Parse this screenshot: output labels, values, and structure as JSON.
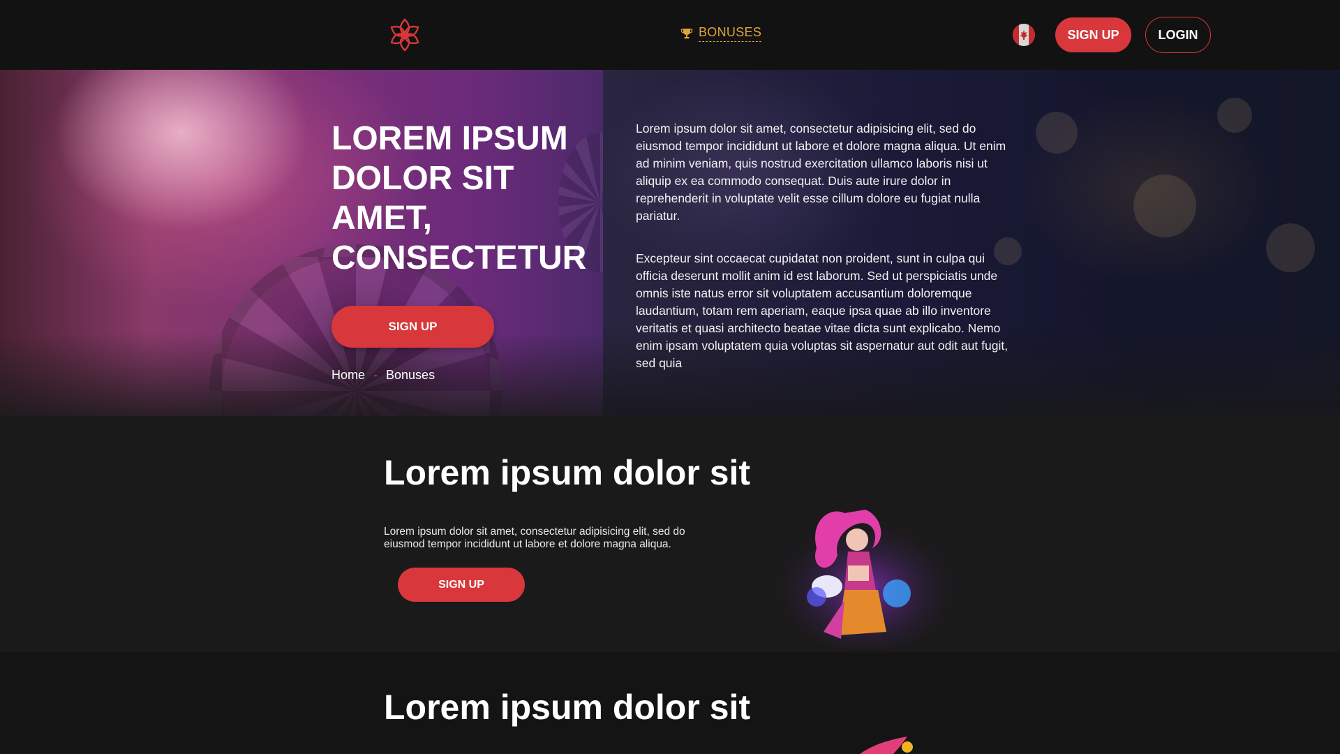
{
  "header": {
    "nav_bonuses": "BONUSES",
    "signup": "SIGN UP",
    "login": "LOGIN"
  },
  "hero": {
    "title": "LOREM IPSUM DOLOR SIT AMET, CONSECTETUR",
    "signup": "SIGN UP",
    "breadcrumb": {
      "home": "Home",
      "separator": "-",
      "current": "Bonuses"
    },
    "paragraph1": "Lorem ipsum dolor sit amet, consectetur adipisicing elit, sed do eiusmod tempor incididunt ut labore et dolore magna aliqua. Ut enim ad minim veniam, quis nostrud exercitation ullamco laboris nisi ut aliquip ex ea commodo consequat. Duis aute irure dolor in reprehenderit in voluptate velit esse cillum dolore eu fugiat nulla pariatur.",
    "paragraph2": "Excepteur sint occaecat cupidatat non proident, sunt in culpa qui officia deserunt mollit anim id est laborum. Sed ut perspiciatis unde omnis iste natus error sit voluptatem accusantium doloremque laudantium, totam rem aperiam, eaque ipsa quae ab illo inventore veritatis et quasi architecto beatae vitae dicta sunt explicabo. Nemo enim ipsam voluptatem quia voluptas sit aspernatur aut odit aut fugit, sed quia"
  },
  "section1": {
    "title": "Lorem ipsum dolor sit",
    "text": "Lorem ipsum dolor sit amet, consectetur adipisicing elit, sed do eiusmod tempor incididunt ut labore et dolore magna aliqua.",
    "signup": "SIGN UP"
  },
  "section2": {
    "title": "Lorem ipsum dolor sit"
  },
  "colors": {
    "accent": "#d8383b",
    "nav_active": "#e2a33c",
    "background": "#1a1a1a",
    "header_bg": "#121212"
  },
  "icons": {
    "logo": "flower-logo-icon",
    "nav": "trophy-icon",
    "language": "canada-flag-icon"
  }
}
